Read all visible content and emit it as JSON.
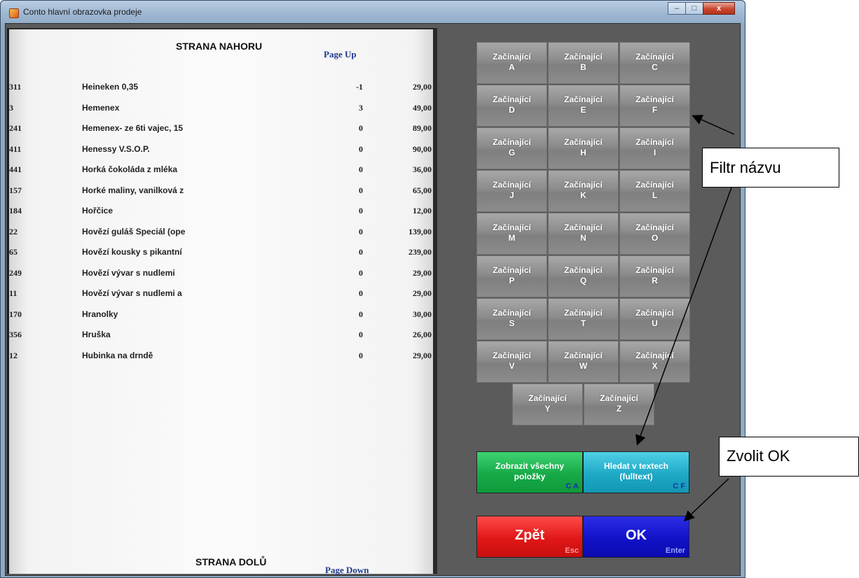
{
  "window": {
    "title": "Conto hlavní obrazovka prodeje",
    "controls": {
      "minimize": "–",
      "maximize": "□",
      "close": "x"
    }
  },
  "list": {
    "page_up_title": "STRANA NAHORU",
    "page_up_key": "Page Up",
    "page_down_title": "STRANA DOLŮ",
    "page_down_key": "Page Down",
    "rows": [
      {
        "code": "311",
        "name": "Heineken 0,35",
        "qty": "-1",
        "price": "29,00"
      },
      {
        "code": "3",
        "name": "Hemenex",
        "qty": "3",
        "price": "49,00"
      },
      {
        "code": "241",
        "name": "Hemenex- ze 6ti vajec, 15",
        "qty": "0",
        "price": "89,00"
      },
      {
        "code": "411",
        "name": "Henessy V.S.O.P.",
        "qty": "0",
        "price": "90,00"
      },
      {
        "code": "441",
        "name": "Horká čokoláda z mléka",
        "qty": "0",
        "price": "36,00"
      },
      {
        "code": "157",
        "name": "Horké maliny, vanilková z",
        "qty": "0",
        "price": "65,00"
      },
      {
        "code": "184",
        "name": "Hořčice",
        "qty": "0",
        "price": "12,00"
      },
      {
        "code": "22",
        "name": "Hovězí guláš Speciál (ope",
        "qty": "0",
        "price": "139,00"
      },
      {
        "code": "65",
        "name": "Hovězí kousky s pikantní",
        "qty": "0",
        "price": "239,00"
      },
      {
        "code": "249",
        "name": "Hovězí vývar s nudlemi",
        "qty": "0",
        "price": "29,00"
      },
      {
        "code": "11",
        "name": "Hovězí vývar s nudlemi a",
        "qty": "0",
        "price": "29,00"
      },
      {
        "code": "170",
        "name": "Hranolky",
        "qty": "0",
        "price": "30,00"
      },
      {
        "code": "356",
        "name": "Hruška",
        "qty": "0",
        "price": "26,00"
      },
      {
        "code": "12",
        "name": "Hubinka na drndě",
        "qty": "0",
        "price": "29,00"
      }
    ]
  },
  "letter_buttons": {
    "prefix": "Začínající",
    "letters": [
      "A",
      "B",
      "C",
      "D",
      "E",
      "F",
      "G",
      "H",
      "I",
      "J",
      "K",
      "L",
      "M",
      "N",
      "O",
      "P",
      "Q",
      "R",
      "S",
      "T",
      "U",
      "V",
      "W",
      "X",
      "Y",
      "Z"
    ]
  },
  "actions": {
    "show_all": {
      "label": "Zobrazit všechny položky",
      "hotkey": "C A"
    },
    "fulltext": {
      "label": "Hledat v textech (fulltext)",
      "hotkey": "C F"
    },
    "back": {
      "label": "Zpět",
      "hotkey": "Esc"
    },
    "ok": {
      "label": "OK",
      "hotkey": "Enter"
    }
  },
  "annotations": {
    "filter_label": "Filtr názvu",
    "ok_label": "Zvolit OK"
  }
}
